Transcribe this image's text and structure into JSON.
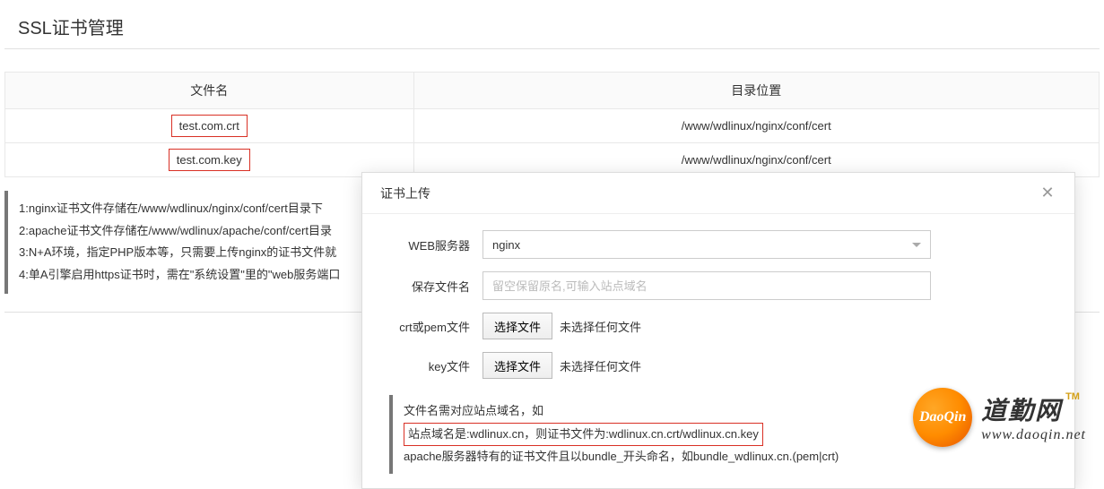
{
  "page": {
    "title": "SSL证书管理"
  },
  "table": {
    "headers": {
      "filename": "文件名",
      "path": "目录位置"
    },
    "rows": [
      {
        "filename": "test.com.crt",
        "path": "/www/wdlinux/nginx/conf/cert"
      },
      {
        "filename": "test.com.key",
        "path": "/www/wdlinux/nginx/conf/cert"
      }
    ]
  },
  "notes": {
    "line1": "1:nginx证书文件存储在/www/wdlinux/nginx/conf/cert目录下",
    "line2": "2:apache证书文件存储在/www/wdlinux/apache/conf/cert目录",
    "line3": "3:N+A环境，指定PHP版本等，只需要上传nginx的证书文件就",
    "line4": "4:单A引擎启用https证书时，需在\"系统设置\"里的\"web服务端口"
  },
  "modal": {
    "title": "证书上传",
    "labels": {
      "webserver": "WEB服务器",
      "savefilename": "保存文件名",
      "crtfile": "crt或pem文件",
      "keyfile": "key文件"
    },
    "webserver_value": "nginx",
    "savefilename_placeholder": "留空保留原名,可输入站点域名",
    "choose_file_btn": "选择文件",
    "no_file_text": "未选择任何文件",
    "notes": {
      "line1": "文件名需对应站点域名，如",
      "line2": "站点域名是:wdlinux.cn，则证书文件为:wdlinux.cn.crt/wdlinux.cn.key",
      "line3": "apache服务器特有的证书文件且以bundle_开头命名，如bundle_wdlinux.cn.(pem|crt)"
    }
  },
  "watermark": {
    "logo_text": "DaoQin",
    "cn": "道勤网",
    "tm": "TM",
    "url": "www.daoqin.net"
  }
}
